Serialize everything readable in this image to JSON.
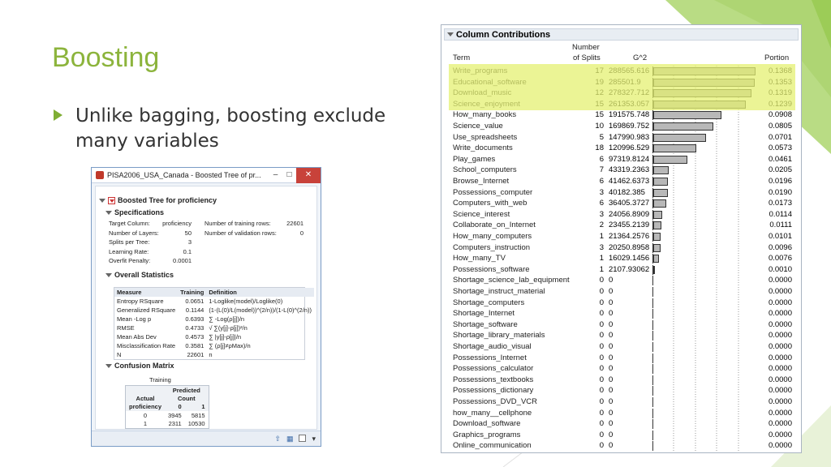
{
  "slide": {
    "title": "Boosting",
    "bullet": "Unlike bagging, boosting exclude many variables",
    "accent_color": "#8cb43c"
  },
  "jmp": {
    "window_title": "PISA2006_USA_Canada - Boosted Tree of pr...",
    "minimize": "–",
    "maximize": "□",
    "close": "✕",
    "report_title": "Boosted Tree for proficiency",
    "spec_header": "Specifications",
    "specs_left": [
      {
        "label": "Target Column:",
        "value": "proficiency"
      },
      {
        "label": "Number of Layers:",
        "value": "50"
      },
      {
        "label": "Splits per Tree:",
        "value": "3"
      },
      {
        "label": "Learning Rate:",
        "value": "0.1"
      },
      {
        "label": "Overfit Penalty:",
        "value": "0.0001"
      }
    ],
    "specs_right": [
      {
        "label": "Number of training rows:",
        "value": "22601"
      },
      {
        "label": "Number of validation rows:",
        "value": "0"
      }
    ],
    "overall_header": "Overall Statistics",
    "stats_columns": [
      "Measure",
      "Training",
      "Definition"
    ],
    "stats_rows": [
      [
        "Entropy RSquare",
        "0.0651",
        "1-Loglike(model)/Loglike(0)"
      ],
      [
        "Generalized RSquare",
        "0.1144",
        "(1-(L(0)/L(model))^(2/n))/(1-L(0)^(2/n))"
      ],
      [
        "Mean -Log p",
        "0.6393",
        "∑ -Log(ρ[j])/n"
      ],
      [
        "RMSE",
        "0.4733",
        "√ ∑(y[j]-ρ[j])²/n"
      ],
      [
        "Mean Abs Dev",
        "0.4573",
        "∑ |y[j]-ρ[j]|/n"
      ],
      [
        "Misclassification Rate",
        "0.3581",
        "∑ (ρ[j]≠ρMax)/n"
      ],
      [
        "N",
        "22601",
        "n"
      ]
    ],
    "confusion_header": "Confusion Matrix",
    "confusion": {
      "caption": "Training",
      "predicted": "Predicted",
      "count": "Count",
      "actual": "Actual",
      "proficiency": "proficiency",
      "col_labels": [
        "0",
        "1"
      ],
      "rows": [
        {
          "label": "0",
          "values": [
            "3945",
            "5815"
          ]
        },
        {
          "label": "1",
          "values": [
            "2311",
            "10530"
          ]
        }
      ]
    },
    "status_icons": [
      "up-arrow",
      "grid",
      "checkbox"
    ]
  },
  "contributions": {
    "title": "Column Contributions",
    "col_term": "Term",
    "col_splits_1": "Number",
    "col_splits_2": "of Splits",
    "col_g2": "G^2",
    "col_portion": "Portion",
    "max_portion": 0.1368,
    "rows": [
      {
        "term": "Write_programs",
        "splits": "17",
        "g2": "288565.616",
        "portion": "0.1368",
        "p": 0.1368
      },
      {
        "term": "Educational_software",
        "splits": "19",
        "g2": "285501.9",
        "portion": "0.1353",
        "p": 0.1353
      },
      {
        "term": "Download_music",
        "splits": "12",
        "g2": "278327.712",
        "portion": "0.1319",
        "p": 0.1319
      },
      {
        "term": "Science_enjoyment",
        "splits": "15",
        "g2": "261353.057",
        "portion": "0.1239",
        "p": 0.1239
      },
      {
        "term": "How_many_books",
        "splits": "15",
        "g2": "191575.748",
        "portion": "0.0908",
        "p": 0.0908
      },
      {
        "term": "Science_value",
        "splits": "10",
        "g2": "169869.752",
        "portion": "0.0805",
        "p": 0.0805
      },
      {
        "term": "Use_spreadsheets",
        "splits": "5",
        "g2": "147990.983",
        "portion": "0.0701",
        "p": 0.0701
      },
      {
        "term": "Write_documents",
        "splits": "18",
        "g2": "120996.529",
        "portion": "0.0573",
        "p": 0.0573
      },
      {
        "term": "Play_games",
        "splits": "6",
        "g2": "97319.8124",
        "portion": "0.0461",
        "p": 0.0461
      },
      {
        "term": "School_computers",
        "splits": "7",
        "g2": "43319.2363",
        "portion": "0.0205",
        "p": 0.0205
      },
      {
        "term": "Browse_Internet",
        "splits": "6",
        "g2": "41462.6373",
        "portion": "0.0196",
        "p": 0.0196
      },
      {
        "term": "Possessions_computer",
        "splits": "3",
        "g2": "40182.385",
        "portion": "0.0190",
        "p": 0.019
      },
      {
        "term": "Computers_with_web",
        "splits": "6",
        "g2": "36405.3727",
        "portion": "0.0173",
        "p": 0.0173
      },
      {
        "term": "Science_interest",
        "splits": "3",
        "g2": "24056.8909",
        "portion": "0.0114",
        "p": 0.0114
      },
      {
        "term": "Collaborate_on_Internet",
        "splits": "2",
        "g2": "23455.2139",
        "portion": "0.0111",
        "p": 0.0111
      },
      {
        "term": "How_many_computers",
        "splits": "1",
        "g2": "21364.2576",
        "portion": "0.0101",
        "p": 0.0101
      },
      {
        "term": "Computers_instruction",
        "splits": "3",
        "g2": "20250.8958",
        "portion": "0.0096",
        "p": 0.0096
      },
      {
        "term": "How_many_TV",
        "splits": "1",
        "g2": "16029.1456",
        "portion": "0.0076",
        "p": 0.0076
      },
      {
        "term": "Possessions_software",
        "splits": "1",
        "g2": "2107.93062",
        "portion": "0.0010",
        "p": 0.001
      },
      {
        "term": "Shortage_science_lab_equipment",
        "splits": "0",
        "g2": "0",
        "portion": "0.0000",
        "p": 0
      },
      {
        "term": "Shortage_instruct_material",
        "splits": "0",
        "g2": "0",
        "portion": "0.0000",
        "p": 0
      },
      {
        "term": "Shortage_computers",
        "splits": "0",
        "g2": "0",
        "portion": "0.0000",
        "p": 0
      },
      {
        "term": "Shortage_Internet",
        "splits": "0",
        "g2": "0",
        "portion": "0.0000",
        "p": 0
      },
      {
        "term": "Shortage_software",
        "splits": "0",
        "g2": "0",
        "portion": "0.0000",
        "p": 0
      },
      {
        "term": "Shortage_library_materials",
        "splits": "0",
        "g2": "0",
        "portion": "0.0000",
        "p": 0
      },
      {
        "term": "Shortage_audio_visual",
        "splits": "0",
        "g2": "0",
        "portion": "0.0000",
        "p": 0
      },
      {
        "term": "Possessions_Internet",
        "splits": "0",
        "g2": "0",
        "portion": "0.0000",
        "p": 0
      },
      {
        "term": "Possessions_calculator",
        "splits": "0",
        "g2": "0",
        "portion": "0.0000",
        "p": 0
      },
      {
        "term": "Possessions_textbooks",
        "splits": "0",
        "g2": "0",
        "portion": "0.0000",
        "p": 0
      },
      {
        "term": "Possessions_dictionary",
        "splits": "0",
        "g2": "0",
        "portion": "0.0000",
        "p": 0
      },
      {
        "term": "Possessions_DVD_VCR",
        "splits": "0",
        "g2": "0",
        "portion": "0.0000",
        "p": 0
      },
      {
        "term": "how_many__cellphone",
        "splits": "0",
        "g2": "0",
        "portion": "0.0000",
        "p": 0
      },
      {
        "term": "Download_software",
        "splits": "0",
        "g2": "0",
        "portion": "0.0000",
        "p": 0
      },
      {
        "term": "Graphics_programs",
        "splits": "0",
        "g2": "0",
        "portion": "0.0000",
        "p": 0
      },
      {
        "term": "Online_communication",
        "splits": "0",
        "g2": "0",
        "portion": "0.0000",
        "p": 0
      }
    ]
  }
}
